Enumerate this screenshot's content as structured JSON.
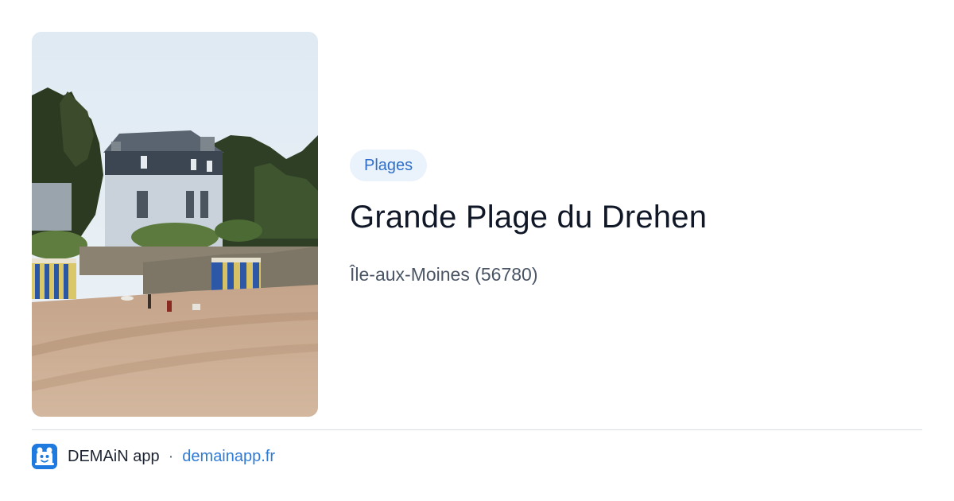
{
  "card": {
    "category": "Plages",
    "title": "Grande Plage du Drehen",
    "location": "Île-aux-Moines (56780)"
  },
  "photo": {
    "alt": "Grande Plage du Drehen"
  },
  "footer": {
    "app_name": "DEMAiN app",
    "separator": "·",
    "url": "demainapp.fr"
  },
  "colors": {
    "badge_bg": "#eaf2fc",
    "badge_text": "#2f6fc9",
    "link": "#2f7bd6",
    "logo_bg": "#1f7ae0"
  },
  "icons": {
    "logo": "demain-app-logo-icon"
  }
}
